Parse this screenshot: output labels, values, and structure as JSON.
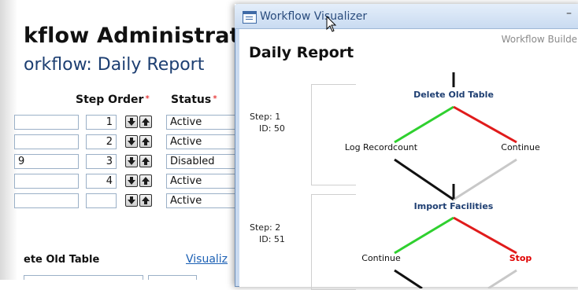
{
  "admin": {
    "title": "kflow Administrat",
    "subtitle": "orkflow: Daily Report",
    "columns": {
      "step_order": "Step Order",
      "status": "Status"
    },
    "rows": [
      {
        "name": "",
        "order": "1",
        "status": "Active"
      },
      {
        "name": "",
        "order": "2",
        "status": "Active"
      },
      {
        "name": "9",
        "order": "3",
        "status": "Disabled"
      },
      {
        "name": "",
        "order": "4",
        "status": "Active"
      },
      {
        "name": "",
        "order": "",
        "status": "Active"
      }
    ],
    "section_label": "ete Old Table",
    "visualize_link": "Visualiz"
  },
  "visualizer": {
    "window_title": "Workflow Visualizer",
    "builder_label": "Workflow Builder",
    "report_title": "Daily Report",
    "steps": [
      {
        "step_label": "Step: 1",
        "id_label": "ID: 50",
        "node_title": "Delete Old Table",
        "left_branch": "Log Recordcount",
        "right_branch": "Continue",
        "right_is_stop": false
      },
      {
        "step_label": "Step: 2",
        "id_label": "ID: 51",
        "node_title": "Import Facilities",
        "left_branch": "Continue",
        "right_branch": "Stop",
        "right_is_stop": true
      }
    ],
    "colors": {
      "success": "#2fd02f",
      "failure": "#e01b1b",
      "default": "#c8c8c8",
      "connector": "#111111"
    }
  },
  "icons": {
    "window": "window-app-icon",
    "down": "arrow-down-icon",
    "up": "arrow-up-icon",
    "cursor": "mouse-pointer-icon"
  }
}
